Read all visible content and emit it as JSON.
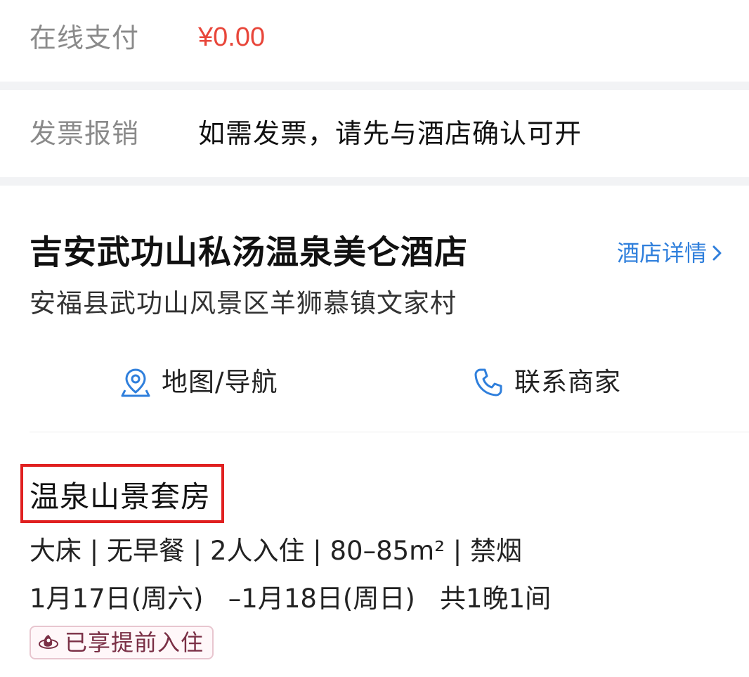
{
  "payment": {
    "label": "在线支付",
    "amount": "¥0.00"
  },
  "invoice": {
    "label": "发票报销",
    "value": "如需发票，请先与酒店确认可开"
  },
  "hotel": {
    "name": "吉安武功山私汤温泉美仑酒店",
    "detail_link": "酒店详情",
    "address": "安福县武功山风景区羊狮慕镇文家村",
    "actions": {
      "map_label": "地图/导航",
      "contact_label": "联系商家"
    }
  },
  "room": {
    "name": "温泉山景套房",
    "info": "大床 | 无早餐 | 2人入住 | 80–85m² | 禁烟",
    "dates": "1月17日(周六)   –1月18日(周日)   共1晚1间",
    "badge": "已享提前入住"
  },
  "colors": {
    "accent_blue": "#2f7fdc",
    "price_red": "#e8463a",
    "highlight_red": "#e02020",
    "badge_text": "#7a2f45"
  },
  "icons": {
    "detail": "chevron-right-icon",
    "map": "map-pin-icon",
    "contact": "phone-icon",
    "badge": "early-checkin-icon"
  }
}
